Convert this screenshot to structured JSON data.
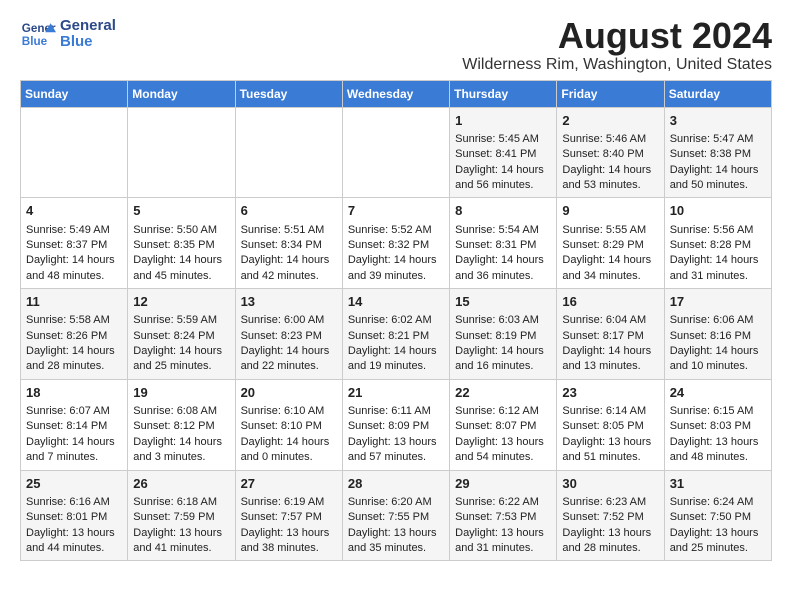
{
  "header": {
    "logo_line1": "General",
    "logo_line2": "Blue",
    "title": "August 2024",
    "subtitle": "Wilderness Rim, Washington, United States"
  },
  "calendar": {
    "days_of_week": [
      "Sunday",
      "Monday",
      "Tuesday",
      "Wednesday",
      "Thursday",
      "Friday",
      "Saturday"
    ],
    "weeks": [
      [
        {
          "day": "",
          "content": ""
        },
        {
          "day": "",
          "content": ""
        },
        {
          "day": "",
          "content": ""
        },
        {
          "day": "",
          "content": ""
        },
        {
          "day": "1",
          "content": "Sunrise: 5:45 AM\nSunset: 8:41 PM\nDaylight: 14 hours\nand 56 minutes."
        },
        {
          "day": "2",
          "content": "Sunrise: 5:46 AM\nSunset: 8:40 PM\nDaylight: 14 hours\nand 53 minutes."
        },
        {
          "day": "3",
          "content": "Sunrise: 5:47 AM\nSunset: 8:38 PM\nDaylight: 14 hours\nand 50 minutes."
        }
      ],
      [
        {
          "day": "4",
          "content": "Sunrise: 5:49 AM\nSunset: 8:37 PM\nDaylight: 14 hours\nand 48 minutes."
        },
        {
          "day": "5",
          "content": "Sunrise: 5:50 AM\nSunset: 8:35 PM\nDaylight: 14 hours\nand 45 minutes."
        },
        {
          "day": "6",
          "content": "Sunrise: 5:51 AM\nSunset: 8:34 PM\nDaylight: 14 hours\nand 42 minutes."
        },
        {
          "day": "7",
          "content": "Sunrise: 5:52 AM\nSunset: 8:32 PM\nDaylight: 14 hours\nand 39 minutes."
        },
        {
          "day": "8",
          "content": "Sunrise: 5:54 AM\nSunset: 8:31 PM\nDaylight: 14 hours\nand 36 minutes."
        },
        {
          "day": "9",
          "content": "Sunrise: 5:55 AM\nSunset: 8:29 PM\nDaylight: 14 hours\nand 34 minutes."
        },
        {
          "day": "10",
          "content": "Sunrise: 5:56 AM\nSunset: 8:28 PM\nDaylight: 14 hours\nand 31 minutes."
        }
      ],
      [
        {
          "day": "11",
          "content": "Sunrise: 5:58 AM\nSunset: 8:26 PM\nDaylight: 14 hours\nand 28 minutes."
        },
        {
          "day": "12",
          "content": "Sunrise: 5:59 AM\nSunset: 8:24 PM\nDaylight: 14 hours\nand 25 minutes."
        },
        {
          "day": "13",
          "content": "Sunrise: 6:00 AM\nSunset: 8:23 PM\nDaylight: 14 hours\nand 22 minutes."
        },
        {
          "day": "14",
          "content": "Sunrise: 6:02 AM\nSunset: 8:21 PM\nDaylight: 14 hours\nand 19 minutes."
        },
        {
          "day": "15",
          "content": "Sunrise: 6:03 AM\nSunset: 8:19 PM\nDaylight: 14 hours\nand 16 minutes."
        },
        {
          "day": "16",
          "content": "Sunrise: 6:04 AM\nSunset: 8:17 PM\nDaylight: 14 hours\nand 13 minutes."
        },
        {
          "day": "17",
          "content": "Sunrise: 6:06 AM\nSunset: 8:16 PM\nDaylight: 14 hours\nand 10 minutes."
        }
      ],
      [
        {
          "day": "18",
          "content": "Sunrise: 6:07 AM\nSunset: 8:14 PM\nDaylight: 14 hours\nand 7 minutes."
        },
        {
          "day": "19",
          "content": "Sunrise: 6:08 AM\nSunset: 8:12 PM\nDaylight: 14 hours\nand 3 minutes."
        },
        {
          "day": "20",
          "content": "Sunrise: 6:10 AM\nSunset: 8:10 PM\nDaylight: 14 hours\nand 0 minutes."
        },
        {
          "day": "21",
          "content": "Sunrise: 6:11 AM\nSunset: 8:09 PM\nDaylight: 13 hours\nand 57 minutes."
        },
        {
          "day": "22",
          "content": "Sunrise: 6:12 AM\nSunset: 8:07 PM\nDaylight: 13 hours\nand 54 minutes."
        },
        {
          "day": "23",
          "content": "Sunrise: 6:14 AM\nSunset: 8:05 PM\nDaylight: 13 hours\nand 51 minutes."
        },
        {
          "day": "24",
          "content": "Sunrise: 6:15 AM\nSunset: 8:03 PM\nDaylight: 13 hours\nand 48 minutes."
        }
      ],
      [
        {
          "day": "25",
          "content": "Sunrise: 6:16 AM\nSunset: 8:01 PM\nDaylight: 13 hours\nand 44 minutes."
        },
        {
          "day": "26",
          "content": "Sunrise: 6:18 AM\nSunset: 7:59 PM\nDaylight: 13 hours\nand 41 minutes."
        },
        {
          "day": "27",
          "content": "Sunrise: 6:19 AM\nSunset: 7:57 PM\nDaylight: 13 hours\nand 38 minutes."
        },
        {
          "day": "28",
          "content": "Sunrise: 6:20 AM\nSunset: 7:55 PM\nDaylight: 13 hours\nand 35 minutes."
        },
        {
          "day": "29",
          "content": "Sunrise: 6:22 AM\nSunset: 7:53 PM\nDaylight: 13 hours\nand 31 minutes."
        },
        {
          "day": "30",
          "content": "Sunrise: 6:23 AM\nSunset: 7:52 PM\nDaylight: 13 hours\nand 28 minutes."
        },
        {
          "day": "31",
          "content": "Sunrise: 6:24 AM\nSunset: 7:50 PM\nDaylight: 13 hours\nand 25 minutes."
        }
      ]
    ]
  }
}
